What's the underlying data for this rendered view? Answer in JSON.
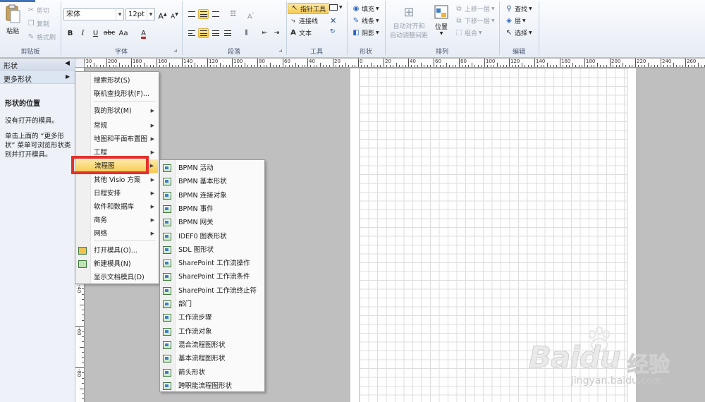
{
  "ribbon": {
    "clipboard": {
      "paste": "粘贴",
      "cut": "剪切",
      "copy": "复制",
      "format_painter": "格式刷",
      "label": "剪贴板"
    },
    "font": {
      "family": "宋体",
      "size": "12pt",
      "grow": "A",
      "shrink": "A",
      "bold": "B",
      "italic": "I",
      "underline": "U",
      "strike": "abc",
      "case": "Aa",
      "color": "A",
      "label": "字体"
    },
    "paragraph": {
      "label": "段落"
    },
    "tools": {
      "pointer": "指针工具",
      "connector": "连接线",
      "text": "文本",
      "label": "工具"
    },
    "shape": {
      "fill": "填充",
      "line": "线条",
      "shadow": "阴影",
      "label": "形状"
    },
    "arrange": {
      "auto_align": "自动对齐和",
      "auto_space": "自动调整间距",
      "position": "位置",
      "bring_forward": "上移一层",
      "send_backward": "下移一层",
      "group": "组合",
      "label": "排列"
    },
    "editing": {
      "find": "查找",
      "layers": "层",
      "select": "选择",
      "label": "编辑"
    }
  },
  "shapes_panel": {
    "title": "形状",
    "more_shapes": "更多形状",
    "heading": "形状的位置",
    "no_stencils": "没有打开的模具。",
    "hint": "单击上面的 “更多形状” 菜单可浏览形状类别并打开模具。"
  },
  "ruler": {
    "h_ticks": [
      "230",
      "200",
      "180",
      "160",
      "140",
      "120",
      "100",
      "80",
      "60",
      "40",
      "20",
      "0",
      "20",
      "40",
      "60",
      "80",
      "100",
      "120",
      "140",
      "160",
      "180",
      "200",
      "220",
      "240",
      "260"
    ],
    "v_ticks": [
      "60",
      "40",
      "20",
      "0",
      "-20",
      "-40",
      "-60",
      "-80"
    ]
  },
  "menu1": {
    "items": [
      "搜索形状(S)",
      "联机查找形状(F)...",
      "我的形状(M)",
      "常规",
      "地图和平面布置图",
      "工程",
      "流程图",
      "其他 Visio 方案",
      "日程安排",
      "软件和数据库",
      "商务",
      "网络",
      "打开模具(O)...",
      "新建模具(N)",
      "显示文档模具(D)"
    ]
  },
  "menu2": {
    "items": [
      "BPMN 活动",
      "BPMN 基本形状",
      "BPMN 连接对象",
      "BPMN 事件",
      "BPMN 网关",
      "IDEF0 图表形状",
      "SDL 图形状",
      "SharePoint 工作流操作",
      "SharePoint 工作流条件",
      "SharePoint 工作流终止符",
      "部门",
      "工作流步骤",
      "工作流对象",
      "混合流程图形状",
      "基本流程图形状",
      "箭头形状",
      "跨职能流程图形状"
    ]
  },
  "watermark": {
    "brand": "Baidu",
    "product": "经验",
    "url": "jingyan.baidu.com"
  },
  "colors": {
    "highlight": "#f7c94f",
    "callout": "#e5302b",
    "ribbon_bg": "#e6ecf5",
    "font_color": "#d9161a"
  }
}
